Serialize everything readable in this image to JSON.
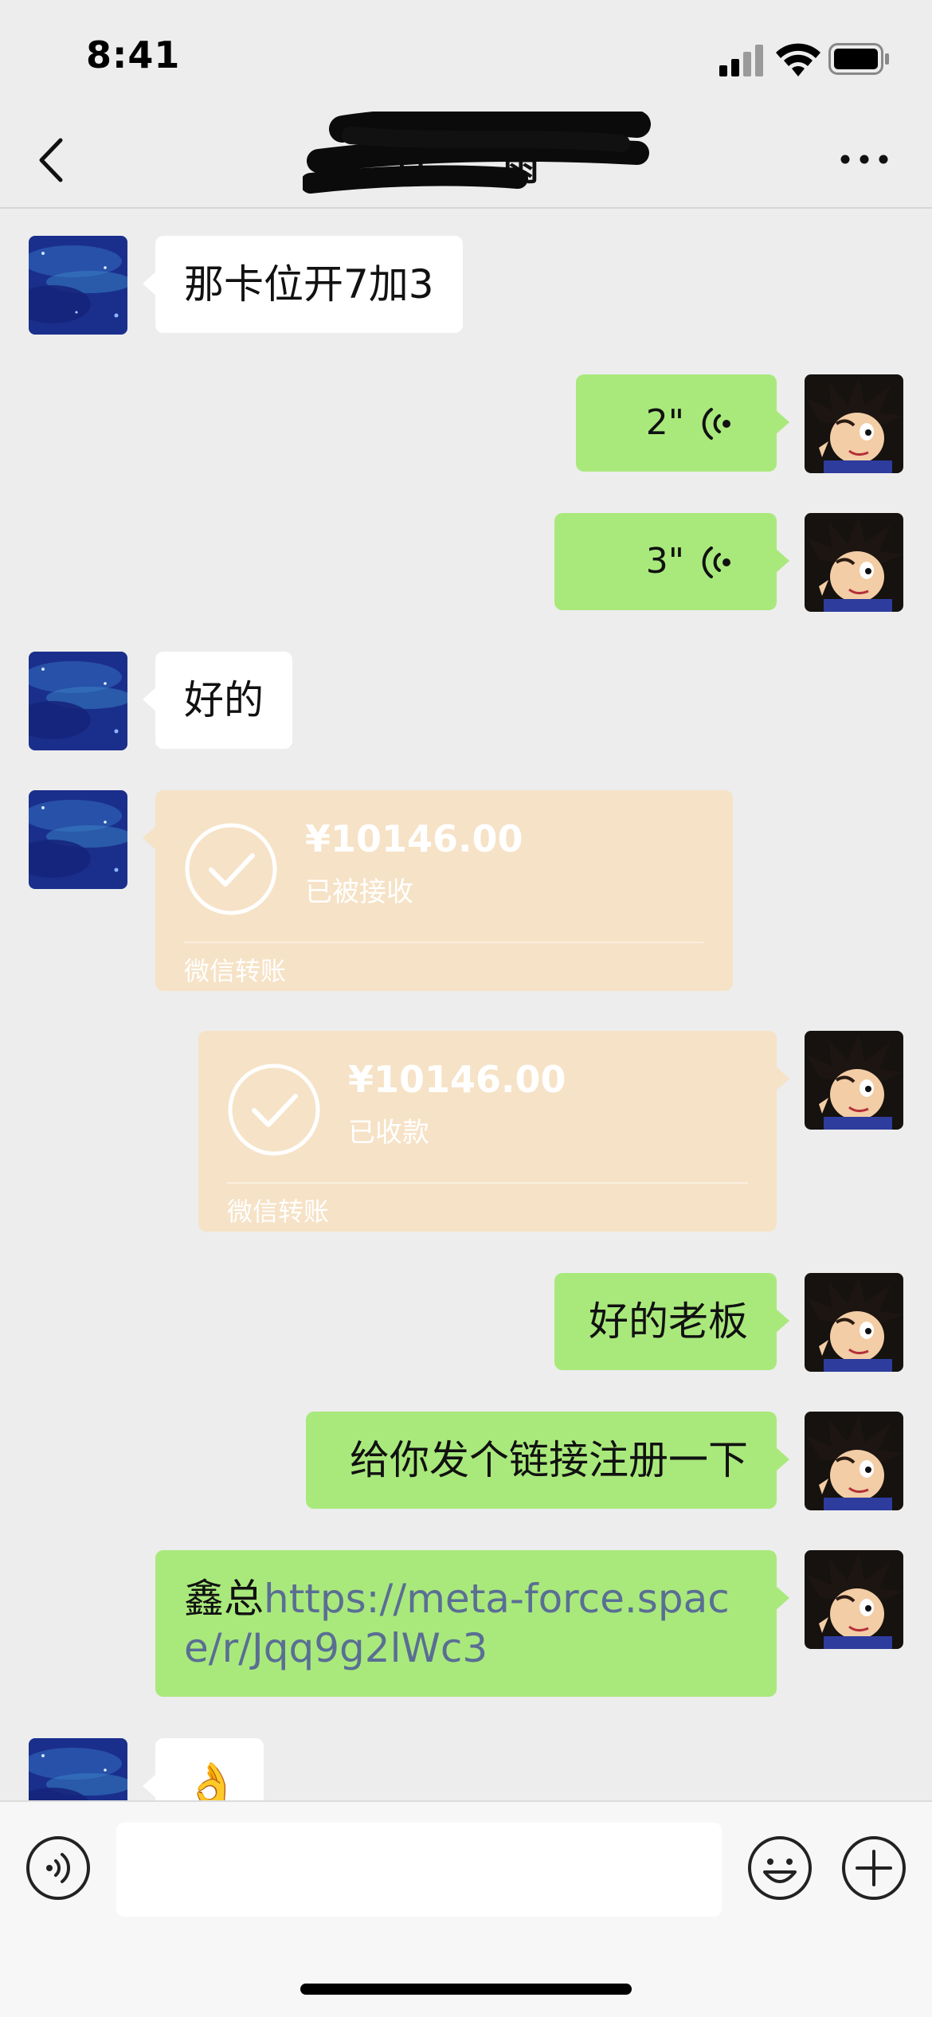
{
  "status_bar": {
    "time": "8:41"
  },
  "nav": {
    "title": "且……雨"
  },
  "messages": {
    "m1": {
      "text": "那卡位开7加3"
    },
    "m2": {
      "duration": "2\""
    },
    "m3": {
      "duration": "3\""
    },
    "m4": {
      "text": "好的"
    },
    "m5": {
      "amount": "¥10146.00",
      "status": "已被接收",
      "source": "微信转账"
    },
    "m6": {
      "amount": "¥10146.00",
      "status": "已收款",
      "source": "微信转账"
    },
    "m7": {
      "text": "好的老板"
    },
    "m8": {
      "text": "给你发个链接注册一下"
    },
    "m9": {
      "prefix": "鑫总",
      "link": "https://meta-force.space/r/Jqq9g2lWc3"
    },
    "m10": {
      "emoji": "👌"
    }
  },
  "input": {
    "value": ""
  },
  "colors": {
    "background": "#ededed",
    "sent_bubble": "#a9e97c",
    "received_bubble": "#ffffff",
    "transfer_card": "#f6e2c6",
    "link": "#5a6e94"
  },
  "icons": [
    "signal-icon",
    "wifi-icon",
    "battery-icon",
    "back-icon",
    "more-icon",
    "voice-message-icon",
    "check-icon",
    "voice-toggle-icon",
    "emoji-icon",
    "plus-icon"
  ]
}
